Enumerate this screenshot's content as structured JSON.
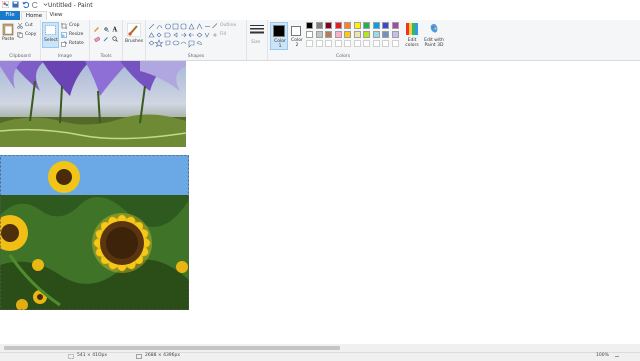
{
  "window": {
    "title": "Untitled - Paint"
  },
  "tabs": [
    {
      "label": "File"
    },
    {
      "label": "Home"
    },
    {
      "label": "View"
    }
  ],
  "ribbon": {
    "clipboard": {
      "paste": "Paste",
      "cut": "Cut",
      "copy": "Copy",
      "group": "Clipboard"
    },
    "image": {
      "select": "Select",
      "crop": "Crop",
      "resize": "Resize",
      "rotate": "Rotate",
      "group": "Image"
    },
    "tools": {
      "group": "Tools"
    },
    "brushes": {
      "label": "Brushes"
    },
    "shapes": {
      "outline": "Outline",
      "fill": "Fill",
      "group": "Shapes"
    },
    "size": {
      "label": "Size"
    },
    "colors": {
      "color1": "Color 1",
      "color2": "Color 2",
      "edit_colors": "Edit colors",
      "edit_paint3d": "Edit with Paint 3D",
      "group": "Colors",
      "palette": [
        "#000000",
        "#7f7f7f",
        "#880015",
        "#ed1c24",
        "#ff7f27",
        "#fff200",
        "#22b14c",
        "#00a2e8",
        "#3f48cc",
        "#a349a4",
        "#ffffff",
        "#c3c3c3",
        "#b97a57",
        "#ffaec9",
        "#ffc90e",
        "#efe4b0",
        "#b5e61d",
        "#99d9ea",
        "#7092be",
        "#c8bfe7"
      ]
    }
  },
  "status": {
    "selection": "541 × 41Opx",
    "size": "2688 × 4396px",
    "zoom": "100%"
  }
}
